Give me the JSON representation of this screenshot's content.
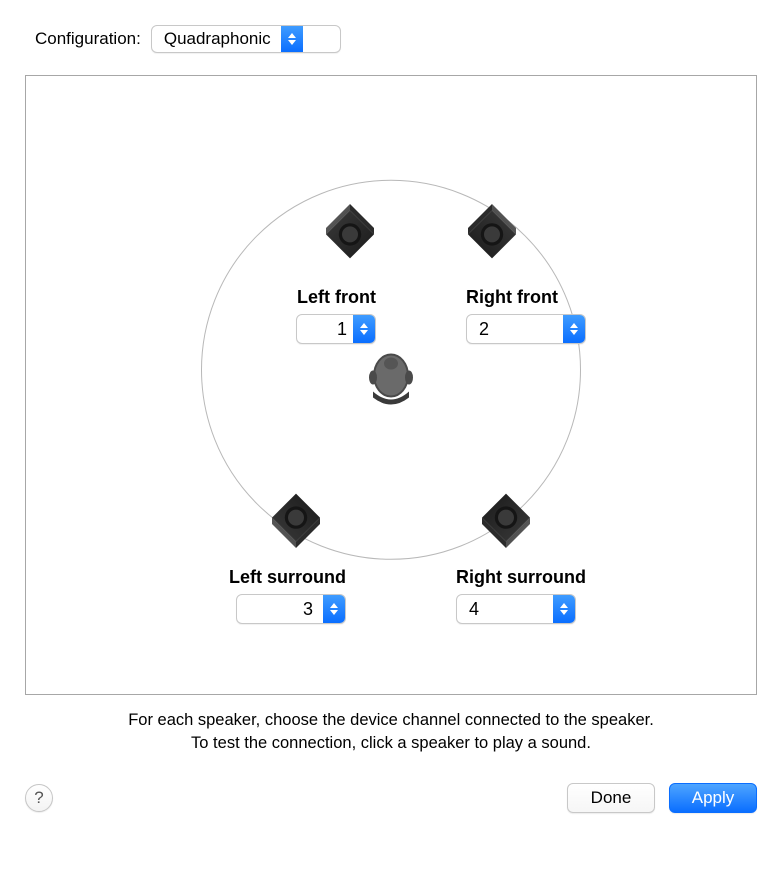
{
  "config": {
    "label": "Configuration:",
    "value": "Quadraphonic"
  },
  "speakers": {
    "leftFront": {
      "label": "Left front",
      "channel": "1"
    },
    "rightFront": {
      "label": "Right front",
      "channel": "2"
    },
    "leftSurround": {
      "label": "Left surround",
      "channel": "3"
    },
    "rightSurround": {
      "label": "Right surround",
      "channel": "4"
    }
  },
  "instructions": {
    "line1": "For each speaker, choose the device channel connected to the speaker.",
    "line2": "To test the connection, click a speaker to play a sound."
  },
  "buttons": {
    "help": "?",
    "done": "Done",
    "apply": "Apply"
  }
}
